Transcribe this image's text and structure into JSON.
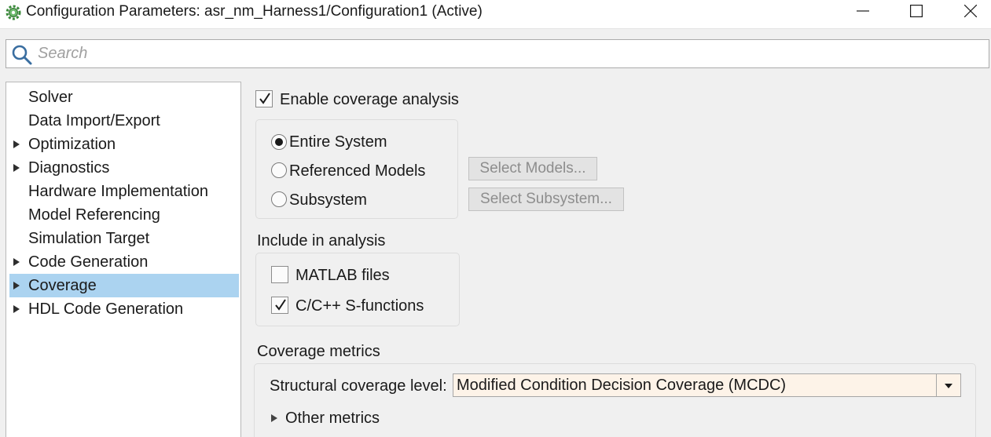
{
  "window": {
    "title": "Configuration Parameters: asr_nm_Harness1/Configuration1 (Active)",
    "app_icon": "gear-cog-icon",
    "controls": {
      "minimize": "minimize-icon",
      "maximize": "maximize-icon",
      "close": "close-icon"
    }
  },
  "search": {
    "placeholder": "Search",
    "value": ""
  },
  "nav": {
    "items": [
      {
        "label": "Solver",
        "expandable": false,
        "selected": false
      },
      {
        "label": "Data Import/Export",
        "expandable": false,
        "selected": false
      },
      {
        "label": "Optimization",
        "expandable": true,
        "selected": false
      },
      {
        "label": "Diagnostics",
        "expandable": true,
        "selected": false
      },
      {
        "label": "Hardware Implementation",
        "expandable": false,
        "selected": false
      },
      {
        "label": "Model Referencing",
        "expandable": false,
        "selected": false
      },
      {
        "label": "Simulation Target",
        "expandable": false,
        "selected": false
      },
      {
        "label": "Code Generation",
        "expandable": true,
        "selected": false
      },
      {
        "label": "Coverage",
        "expandable": true,
        "selected": true
      },
      {
        "label": "HDL Code Generation",
        "expandable": true,
        "selected": false
      }
    ]
  },
  "coverage": {
    "enable_label": "Enable coverage analysis",
    "enable_checked": true,
    "scope": {
      "options": [
        "Entire System",
        "Referenced Models",
        "Subsystem"
      ],
      "selected": "Entire System"
    },
    "select_models_label": "Select Models...",
    "select_subsystem_label": "Select Subsystem...",
    "include": {
      "title": "Include in analysis",
      "matlab_files_label": "MATLAB files",
      "matlab_files_checked": false,
      "sfunctions_label": "C/C++ S-functions",
      "sfunctions_checked": true
    },
    "metrics": {
      "title": "Coverage metrics",
      "structural_label": "Structural coverage level:",
      "structural_value": "Modified Condition Decision Coverage (MCDC)",
      "other_metrics_label": "Other metrics"
    }
  },
  "colors": {
    "selection": "#abd3f0",
    "dropdown_bg": "#fdf3e8",
    "window_bg": "#f0f0f0"
  }
}
